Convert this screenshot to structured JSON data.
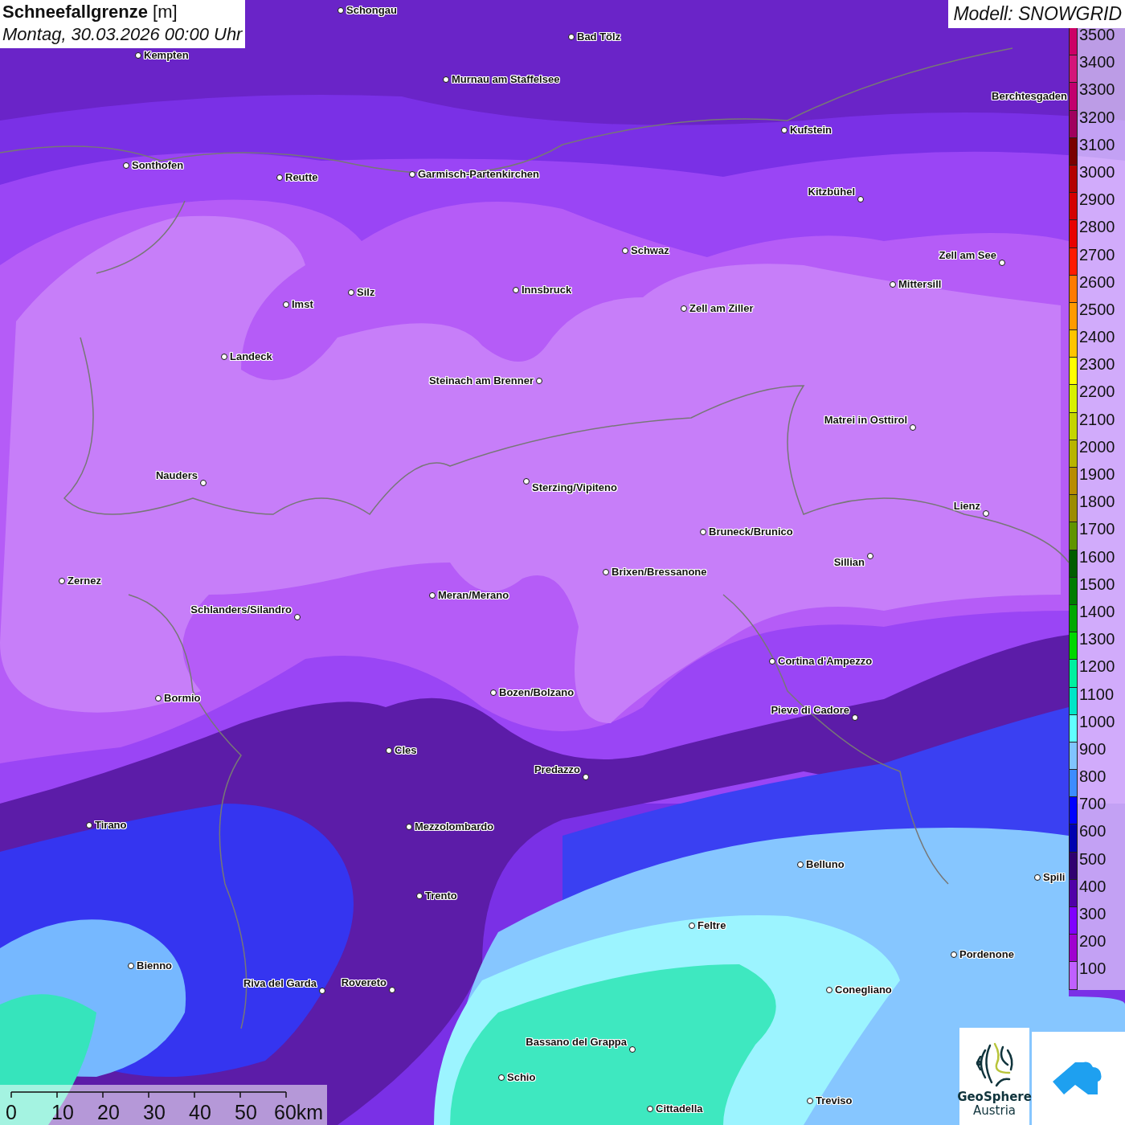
{
  "header": {
    "title": "**Schneefallgrenze** [m]",
    "date": "Montag, 30.03.2026 00:00 Uhr"
  },
  "model": "Modell: SNOWGRID",
  "legend": [
    {
      "label": "3500",
      "color": "#cc0066"
    },
    {
      "label": "3400",
      "color": "#d4157a"
    },
    {
      "label": "3300",
      "color": "#c2006e"
    },
    {
      "label": "3200",
      "color": "#a0005e"
    },
    {
      "label": "3100",
      "color": "#7a0000"
    },
    {
      "label": "3000",
      "color": "#b40000"
    },
    {
      "label": "2900",
      "color": "#d40000"
    },
    {
      "label": "2800",
      "color": "#e80000"
    },
    {
      "label": "2700",
      "color": "#ff1a00"
    },
    {
      "label": "2600",
      "color": "#ff7a00"
    },
    {
      "label": "2500",
      "color": "#ff9a00"
    },
    {
      "label": "2400",
      "color": "#ffc400"
    },
    {
      "label": "2300",
      "color": "#ffff00"
    },
    {
      "label": "2200",
      "color": "#d8f000"
    },
    {
      "label": "2100",
      "color": "#c4d400"
    },
    {
      "label": "2000",
      "color": "#b8b400"
    },
    {
      "label": "1900",
      "color": "#b88c00"
    },
    {
      "label": "1800",
      "color": "#9c8c00"
    },
    {
      "label": "1700",
      "color": "#609400"
    },
    {
      "label": "1600",
      "color": "#005c00"
    },
    {
      "label": "1500",
      "color": "#007c00"
    },
    {
      "label": "1400",
      "color": "#00a800"
    },
    {
      "label": "1300",
      "color": "#00d800"
    },
    {
      "label": "1200",
      "color": "#00f0a0"
    },
    {
      "label": "1100",
      "color": "#00e6c8"
    },
    {
      "label": "1000",
      "color": "#60ffff"
    },
    {
      "label": "900",
      "color": "#80c4ff"
    },
    {
      "label": "800",
      "color": "#3c8cff"
    },
    {
      "label": "700",
      "color": "#0000ff"
    },
    {
      "label": "600",
      "color": "#0000b0"
    },
    {
      "label": "500",
      "color": "#300070"
    },
    {
      "label": "400",
      "color": "#5000a8"
    },
    {
      "label": "300",
      "color": "#8000ff"
    },
    {
      "label": "200",
      "color": "#a000d0"
    },
    {
      "label": "100",
      "color": "#c060ff"
    }
  ],
  "cities": [
    {
      "name": "Schongau"
    },
    {
      "name": "Bad Tölz"
    },
    {
      "name": "Kempten"
    },
    {
      "name": "Murnau am Staffelsee"
    },
    {
      "name": "Berchtesgaden"
    },
    {
      "name": "Kufstein"
    },
    {
      "name": "Sonthofen"
    },
    {
      "name": "Reutte"
    },
    {
      "name": "Garmisch-Partenkirchen"
    },
    {
      "name": "Kitzbühel"
    },
    {
      "name": "Schwaz"
    },
    {
      "name": "Zell am See"
    },
    {
      "name": "Mittersill"
    },
    {
      "name": "Silz"
    },
    {
      "name": "Innsbruck"
    },
    {
      "name": "Imst"
    },
    {
      "name": "Zell am Ziller"
    },
    {
      "name": "Landeck"
    },
    {
      "name": "Steinach am Brenner"
    },
    {
      "name": "Matrei in Osttirol"
    },
    {
      "name": "Nauders"
    },
    {
      "name": "Sterzing/Vipiteno"
    },
    {
      "name": "Lienz"
    },
    {
      "name": "Bruneck/Brunico"
    },
    {
      "name": "Sillian"
    },
    {
      "name": "Zernez"
    },
    {
      "name": "Brixen/Bressanone"
    },
    {
      "name": "Meran/Merano"
    },
    {
      "name": "Schlanders/Silandro"
    },
    {
      "name": "Cortina d'Ampezzo"
    },
    {
      "name": "Bozen/Bolzano"
    },
    {
      "name": "Bormio"
    },
    {
      "name": "Pieve di Cadore"
    },
    {
      "name": "Cles"
    },
    {
      "name": "Predazzo"
    },
    {
      "name": "Tirano"
    },
    {
      "name": "Mezzolombardo"
    },
    {
      "name": "Belluno"
    },
    {
      "name": "Spili"
    },
    {
      "name": "Trento"
    },
    {
      "name": "Feltre"
    },
    {
      "name": "Pordenone"
    },
    {
      "name": "Bienno"
    },
    {
      "name": "Riva del Garda"
    },
    {
      "name": "Rovereto"
    },
    {
      "name": "Conegliano"
    },
    {
      "name": "Bassano del Grappa"
    },
    {
      "name": "Schio"
    },
    {
      "name": "Treviso"
    },
    {
      "name": "Cittadella"
    }
  ],
  "scale_bar": {
    "labels": [
      "0",
      "10",
      "20",
      "30",
      "40",
      "50",
      "60km"
    ]
  },
  "logo": {
    "name": "GeoSphere",
    "subtitle": "Austria"
  }
}
